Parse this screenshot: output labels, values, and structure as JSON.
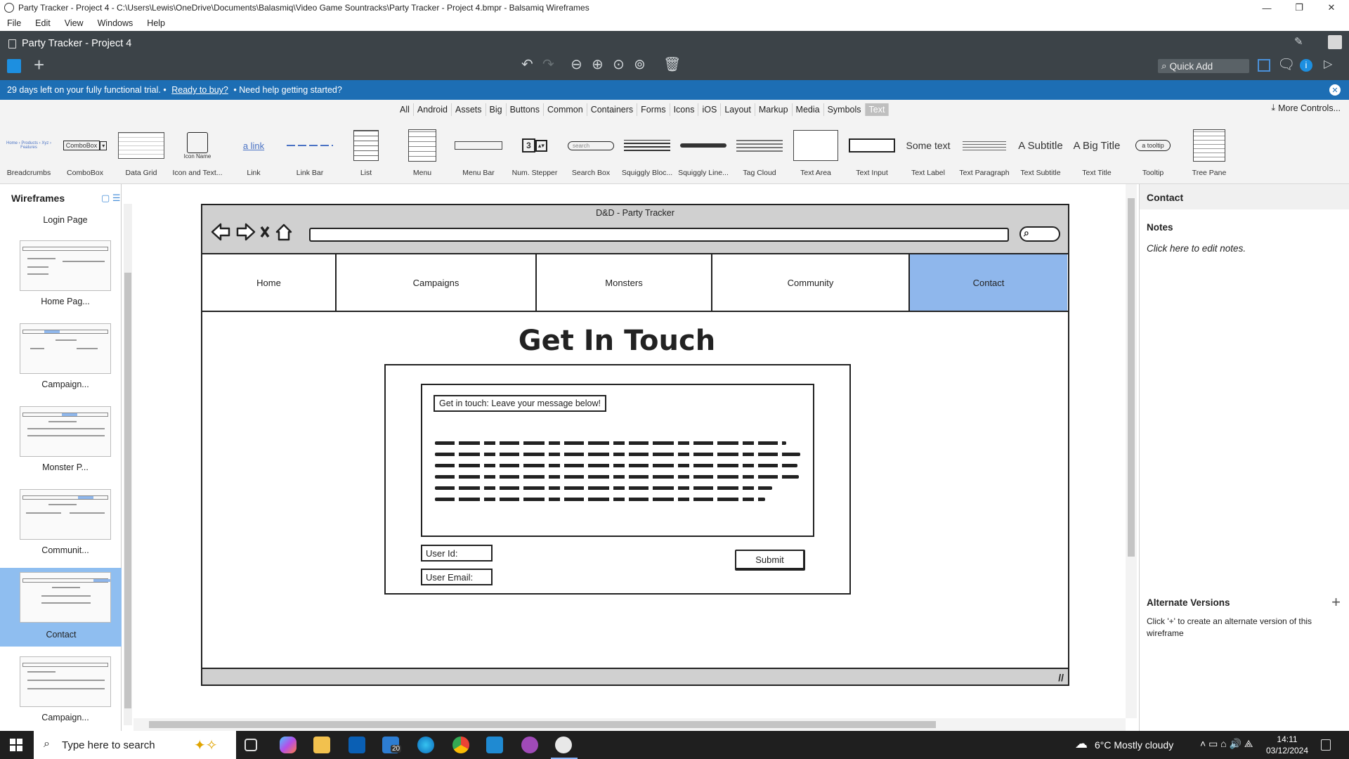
{
  "window": {
    "title": "Party Tracker - Project 4 - C:\\Users\\Lewis\\OneDrive\\Documents\\Balasmiq\\Video Game Sountracks\\Party Tracker - Project 4.bmpr - Balsamiq Wireframes",
    "controls": [
      "—",
      "❐",
      "✕"
    ]
  },
  "menu": [
    "File",
    "Edit",
    "View",
    "Windows",
    "Help"
  ],
  "app": {
    "project_title": "Party Tracker - Project 4",
    "quick_add": "Quick Add"
  },
  "trial": {
    "text": "29 days left on your fully functional trial.",
    "sep1": "•",
    "buy_link": "Ready to buy?",
    "sep2": "•",
    "help": "Need help getting started?"
  },
  "library": {
    "categories": [
      "All",
      "Android",
      "Assets",
      "Big",
      "Buttons",
      "Common",
      "Containers",
      "Forms",
      "Icons",
      "iOS",
      "Layout",
      "Markup",
      "Media",
      "Symbols",
      "Text"
    ],
    "active_category": "Text",
    "more_controls": "More Controls...",
    "items": [
      "Breadcrumbs",
      "ComboBox",
      "Data Grid",
      "Icon and Text...",
      "Link",
      "Link Bar",
      "List",
      "Menu",
      "Menu Bar",
      "Num. Stepper",
      "Search Box",
      "Squiggly Bloc...",
      "Squiggly Line...",
      "Tag Cloud",
      "Text Area",
      "Text Input",
      "Text Label",
      "Text Paragraph",
      "Text Subtitle",
      "Text Title",
      "Tooltip",
      "Tree Pane"
    ],
    "previews": {
      "combobox": "ComboBox",
      "icon_name": "Icon Name",
      "link": "a link",
      "stepper": "3",
      "search": "search",
      "some_text": "Some text",
      "subtitle": "A Subtitle",
      "big_title": "A Big Title",
      "tooltip": "a tooltip"
    }
  },
  "wireframes_panel": {
    "title": "Wireframes",
    "pages": [
      "Login Page",
      "Home Pag...",
      "Campaign...",
      "Monster P...",
      "Communit...",
      "Contact",
      "Campaign..."
    ],
    "selected": "Contact"
  },
  "wireframe": {
    "browser_title": "D&D - Party Tracker",
    "nav": [
      "Home",
      "Campaigns",
      "Monsters",
      "Community",
      "Contact"
    ],
    "active_nav": "Contact",
    "heading": "Get In Touch",
    "message_label": "Get in touch: Leave your message below!",
    "user_id": "User Id:",
    "user_email": "User Email:",
    "submit": "Submit",
    "accent": "#8fb7ec"
  },
  "properties": {
    "title": "Contact",
    "notes_title": "Notes",
    "notes_hint": "Click here to edit notes.",
    "alt_title": "Alternate Versions",
    "alt_hint": "Click '+' to create an alternate version of this wireframe"
  },
  "taskbar": {
    "search_placeholder": "Type here to search",
    "mail_badge": "20",
    "weather": "6°C  Mostly cloudy",
    "time": "14:11",
    "date": "03/12/2024"
  },
  "colors": {
    "header_dark": "#3c4348",
    "trial_blue": "#1d6eb4",
    "selection_blue": "#8fbef0"
  }
}
